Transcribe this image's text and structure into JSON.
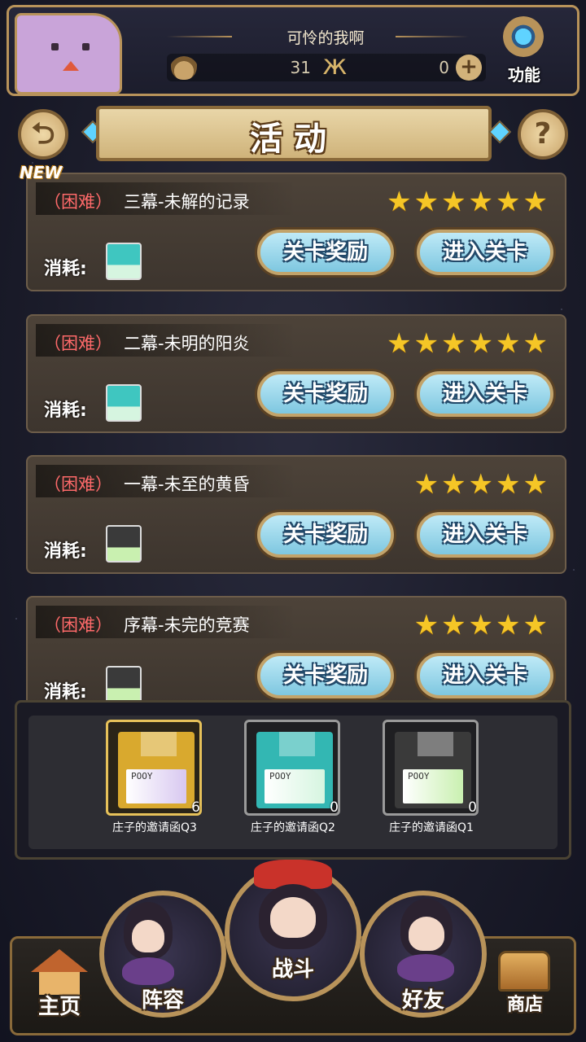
{
  "header": {
    "player_name": "可怜的我啊",
    "resource1_value": "31",
    "resource2_value": "0",
    "function_label": "功能",
    "icons": [
      "flame-icon",
      "butterfly-icon",
      "plus-icon",
      "gear-icon"
    ]
  },
  "titlebar": {
    "title": "活动",
    "back_icon": "back-arrow-icon",
    "help_icon": "?"
  },
  "new_badge": "NEW",
  "stages": [
    {
      "difficulty": "（困难）",
      "name": "三幕-未解的记录",
      "stars": "★★★★★★",
      "cost_label": "消耗:",
      "disk_color": "#3fc6c0",
      "reward_label": "关卡奖励",
      "enter_label": "进入关卡"
    },
    {
      "difficulty": "（困难）",
      "name": "二幕-未明的阳炎",
      "stars": "★★★★★★",
      "cost_label": "消耗:",
      "disk_color": "#3fc6c0",
      "reward_label": "关卡奖励",
      "enter_label": "进入关卡"
    },
    {
      "difficulty": "（困难）",
      "name": "一幕-未至的黄昏",
      "stars": "★★★★★",
      "cost_label": "消耗:",
      "disk_color": "#3a3a3a",
      "reward_label": "关卡奖励",
      "enter_label": "进入关卡"
    },
    {
      "difficulty": "（困难）",
      "name": "序幕-未完的竞赛",
      "stars": "★★★★★",
      "cost_label": "消耗:",
      "disk_color": "#3a3a3a",
      "reward_label": "关卡奖励",
      "enter_label": "进入关卡"
    }
  ],
  "inventory": [
    {
      "name": "庄子的邀请函Q3",
      "count": "6",
      "color": "#d9a92e",
      "border": "#e6c15a"
    },
    {
      "name": "庄子的邀请函Q2",
      "count": "0",
      "color": "#33b7b3",
      "border": "#9a9a9a"
    },
    {
      "name": "庄子的邀请函Q1",
      "count": "0",
      "color": "#3a3a3a",
      "border": "#9a9a9a"
    }
  ],
  "bottom_nav": {
    "home": "主页",
    "team": "阵容",
    "battle": "战斗",
    "friends": "好友",
    "shop": "商店"
  }
}
